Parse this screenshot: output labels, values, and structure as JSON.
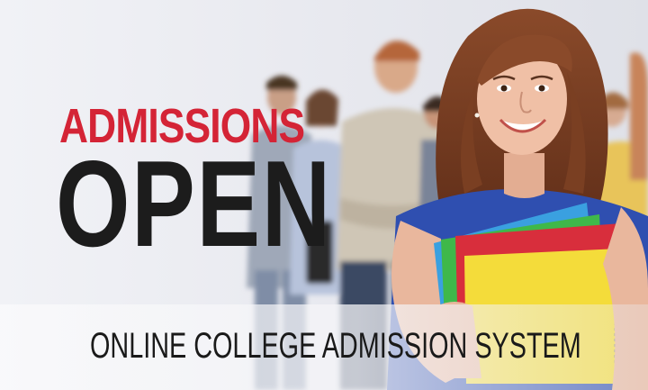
{
  "headline": {
    "line1": "ADMISSIONS",
    "line2": "OPEN"
  },
  "tagline": "ONLINE COLLEGE ADMISSION SYSTEM",
  "colors": {
    "accent_red": "#d42436",
    "text_dark": "#1c1c1c",
    "background": "#ecedf2"
  }
}
